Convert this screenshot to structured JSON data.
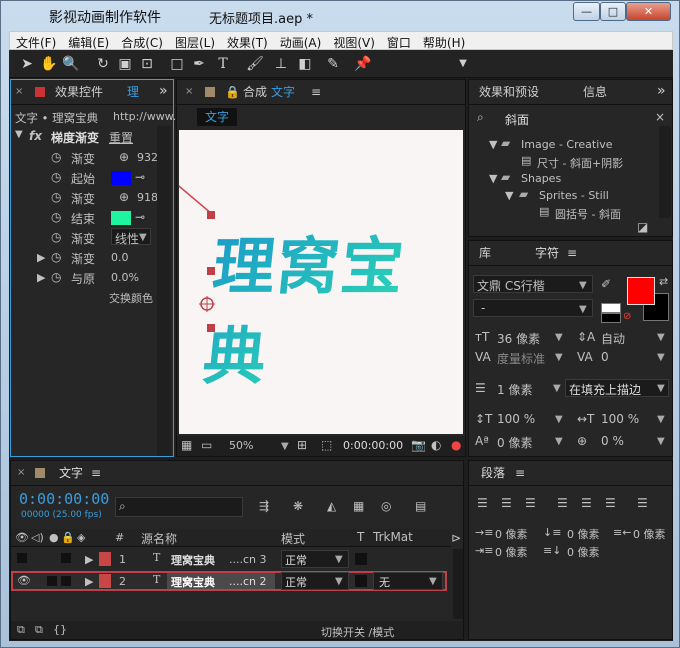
{
  "window": {
    "title": "无标题项目.aep *",
    "app_name": "影视动画制作软件",
    "min": "—",
    "max": "□",
    "close": "✕"
  },
  "menu": [
    "文件(F)",
    "编辑(E)",
    "合成(C)",
    "图层(L)",
    "效果(T)",
    "动画(A)",
    "视图(V)",
    "窗口",
    "帮助(H)"
  ],
  "effects_panel": {
    "tab": "效果控件",
    "tab_suffix": "理",
    "crumb": "文字 • 理窝宝典",
    "url_hint": "http://www.",
    "fx_label": "fx",
    "effect_name": "梯度渐变",
    "reset": "重置",
    "rows": [
      {
        "label": "渐变",
        "value": "932"
      },
      {
        "label": "起始",
        "value": "",
        "color": "#0000ff"
      },
      {
        "label": "渐变",
        "value": "918"
      },
      {
        "label": "结束",
        "value": "",
        "color": "#1ff5a0"
      },
      {
        "label": "渐变",
        "value": "线性"
      },
      {
        "label": "渐变",
        "value": "0.0"
      },
      {
        "label": "与原",
        "value": "0.0%"
      },
      {
        "label": "",
        "value": "交换颜色"
      }
    ]
  },
  "comp_panel": {
    "tab": "合成",
    "comp_name": "文字",
    "subtab": "文字",
    "canvas_text": "理窝宝典",
    "zoom": "50%",
    "timecode": "0:00:00:00"
  },
  "effects_presets": {
    "tab": "效果和预设",
    "tab2": "信息",
    "search": "斜面",
    "items": [
      {
        "label": "Image - Creative",
        "kind": "folder"
      },
      {
        "label": "尺寸 - 斜面+阴影",
        "kind": "preset"
      },
      {
        "label": "Shapes",
        "kind": "folder"
      },
      {
        "label": "Sprites - Still",
        "kind": "folder"
      },
      {
        "label": "圆括号 - 斜面",
        "kind": "preset"
      }
    ]
  },
  "character_panel": {
    "tab_lib": "库",
    "tab": "字符",
    "font": "文鼎 CS行楷",
    "style": "-",
    "fill_color": "#ff0000",
    "size": "36 像素",
    "leading": "自动",
    "kerning_label": "度量标准",
    "tracking": "0",
    "stroke_width": "1 像素",
    "stroke_mode": "在填充上描边",
    "vscale": "100 %",
    "hscale": "100 %",
    "baseline": "0 像素",
    "tsume": "0 %"
  },
  "timeline": {
    "tab": "文字",
    "timecode": "0:00:00:00",
    "fps": "00000 (25.00 fps)",
    "col_num": "#",
    "col_source": "源名称",
    "col_mode": "模式",
    "col_t": "T",
    "col_trkmat": "TrkMat",
    "layers": [
      {
        "num": "1",
        "name": "理窝宝典",
        "suffix": "....cn 3",
        "mode": "正常",
        "trkmat": ""
      },
      {
        "num": "2",
        "name": "理窝宝典",
        "suffix": "....cn 2",
        "mode": "正常",
        "trkmat": "无"
      }
    ],
    "footer": "切换开关 /模式"
  },
  "paragraph_panel": {
    "tab": "段落",
    "v1": "0 像素",
    "v2": "0 像素",
    "v3": "0 像素",
    "v4": "0 像素",
    "v5": "0 像素"
  }
}
